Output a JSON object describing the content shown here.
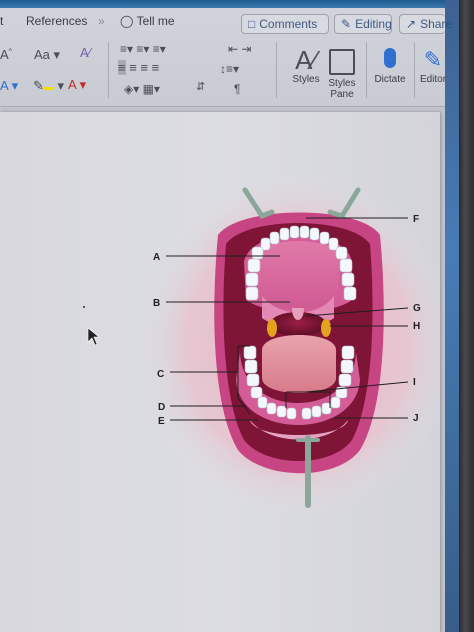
{
  "ribbon": {
    "tabs": [
      "t",
      "References",
      "Tell me"
    ],
    "overflow": "»",
    "comments_label": "Comments",
    "editing_label": "Editing",
    "share_label": "Share",
    "font_size_up": "A",
    "font_case": "Aa",
    "styles_label": "Styles",
    "styles_pane_label": "Styles Pane",
    "dictate_label": "Dictate",
    "editor_label": "Editor"
  },
  "diagram": {
    "labels": [
      "A",
      "B",
      "C",
      "D",
      "E",
      "F",
      "G",
      "H",
      "I",
      "J"
    ]
  },
  "colors": {
    "ribbon_bg": "#d2d4dc",
    "accent_blue": "#3f5a80",
    "lips": "#c2407a",
    "gums": "#d45d98",
    "tongue": "#e59aa6",
    "teeth": "#f4f7fb"
  }
}
